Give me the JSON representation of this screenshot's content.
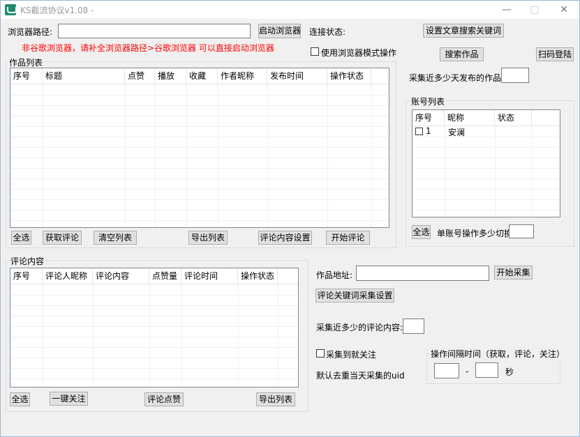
{
  "window": {
    "title": "KS截流协议v1.08 -",
    "minimize": "—",
    "maximize": "□",
    "close": "✕"
  },
  "browser": {
    "path_label": "浏览器路径:",
    "path_value": "",
    "launch_button": "启动浏览器",
    "connect_label": "连接状态:",
    "hint": "非谷歌浏览器，请补全浏览器路径>谷歌浏览器 可以直接启动浏览器",
    "use_browser_mode": "使用浏览器模式操作"
  },
  "top_right": {
    "set_keywords_button": "设置文章搜索关键词",
    "search_button": "搜索作品",
    "scan_login_button": "扫码登陆",
    "recent_days_label": "采集近多少天发布的作品:",
    "recent_days_value": ""
  },
  "works": {
    "group_title": "作品列表",
    "columns": [
      "序号",
      "标题",
      "点赞",
      "播放",
      "收藏",
      "作者昵称",
      "发布时间",
      "操作状态"
    ],
    "buttons": {
      "select_all": "全选",
      "get_comments": "获取评论",
      "clear_list": "清空列表",
      "export_list": "导出列表",
      "comment_settings": "评论内容设置",
      "start_comment": "开始评论"
    }
  },
  "accounts": {
    "group_title": "账号列表",
    "columns": [
      "序号",
      "昵称",
      "状态"
    ],
    "rows": [
      {
        "index": "1",
        "nickname": "安澜",
        "status": ""
      }
    ],
    "select_all": "全选",
    "switch_label": "单账号操作多少切换:",
    "switch_value": ""
  },
  "comments": {
    "group_title": "评论内容",
    "columns": [
      "序号",
      "评论人昵称",
      "评论内容",
      "点赞量",
      "评论时间",
      "操作状态"
    ],
    "buttons": {
      "select_all": "全选",
      "follow_all": "一键关注",
      "like_comments": "评论点赞",
      "export_list": "导出列表"
    }
  },
  "collect": {
    "work_url_label": "作品地址:",
    "work_url_value": "",
    "start_collect_button": "开始采集",
    "keyword_settings_button": "评论关键词采集设置",
    "recent_comments_label": "采集近多少的评论内容:",
    "recent_comments_value": "",
    "follow_on_collect": "采集到就关注",
    "dedupe_hint": "默认去重当天采集的uid",
    "interval_group_title": "操作间隔时间（获取，评论，关注）",
    "interval_min": "",
    "interval_dash": "-",
    "interval_max": "",
    "interval_unit": "秒"
  }
}
